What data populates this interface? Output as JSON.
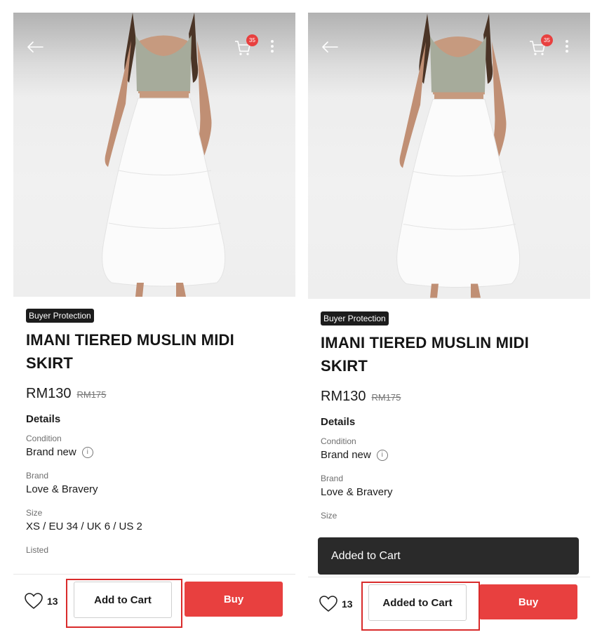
{
  "product": {
    "badge": "Buyer Protection",
    "title_line1": "IMANI TIERED MUSLIN MIDI",
    "title_line2": "SKIRT",
    "price": "RM130",
    "original_price": "RM175"
  },
  "nav": {
    "cart_count": "35",
    "back_icon": "arrow-left-icon",
    "cart_icon": "cart-icon",
    "more_icon": "more-vertical-icon"
  },
  "details": {
    "heading": "Details",
    "condition_label": "Condition",
    "condition_value": "Brand new",
    "brand_label": "Brand",
    "brand_value": "Love & Bravery",
    "size_label": "Size",
    "size_value": "XS / EU 34 / UK 6 / US 2",
    "listed_label": "Listed"
  },
  "actions": {
    "like_count": "13",
    "add_to_cart": "Add to Cart",
    "added_to_cart": "Added to Cart",
    "buy": "Buy"
  },
  "toast": {
    "message": "Added to Cart"
  },
  "colors": {
    "accent_red": "#e8403f",
    "highlight_red": "#d92b2b",
    "toast_bg": "#2a2a2a",
    "badge_bg": "#1c1c1c"
  }
}
